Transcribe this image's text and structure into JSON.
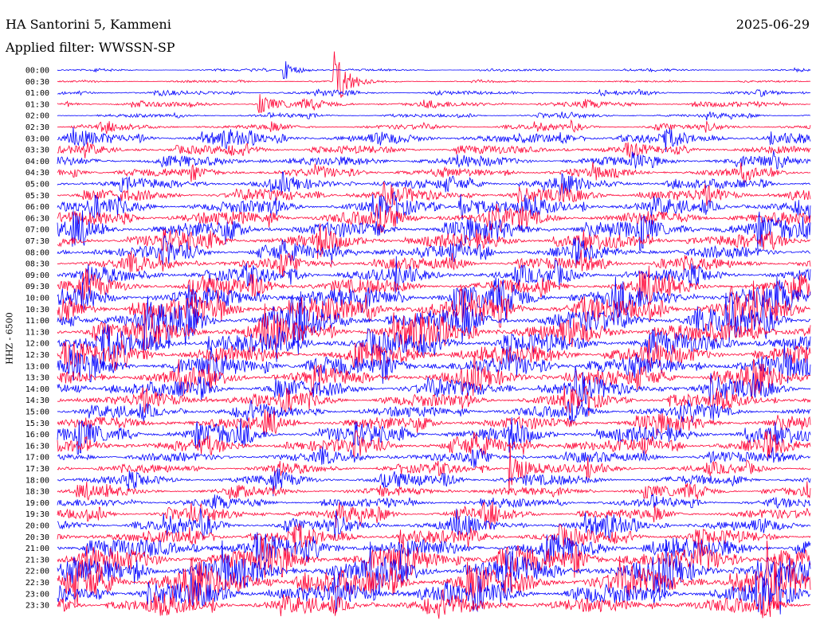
{
  "header": {
    "station": "HA Santorini 5, Kammeni",
    "date": "2025-06-29",
    "filter": "Applied filter: WWSSN-SP"
  },
  "chart_data": {
    "type": "line",
    "title": "HA Santorini 5, Kammeni",
    "ylabel": "HHZ - 6500",
    "rows": [
      "00:00",
      "00:30",
      "01:00",
      "01:30",
      "02:00",
      "02:30",
      "03:00",
      "03:30",
      "04:00",
      "04:30",
      "05:00",
      "05:30",
      "06:00",
      "06:30",
      "07:00",
      "07:30",
      "08:00",
      "08:30",
      "09:00",
      "09:30",
      "10:00",
      "10:30",
      "11:00",
      "11:30",
      "12:00",
      "12:30",
      "13:00",
      "13:30",
      "14:00",
      "14:30",
      "15:00",
      "15:30",
      "16:00",
      "16:30",
      "17:00",
      "17:30",
      "18:00",
      "18:30",
      "19:00",
      "19:30",
      "20:00",
      "20:30",
      "21:00",
      "21:30",
      "22:00",
      "22:30",
      "23:00",
      "23:30"
    ],
    "colors": [
      "#0000ff",
      "#ff0033"
    ],
    "noise_level": [
      1,
      1,
      2,
      3,
      2,
      3,
      6,
      5,
      6,
      5,
      6,
      7,
      8,
      9,
      10,
      9,
      8,
      7,
      8,
      9,
      12,
      14,
      14,
      13,
      12,
      12,
      11,
      10,
      10,
      8,
      7,
      8,
      9,
      8,
      6,
      5,
      6,
      5,
      5,
      6,
      7,
      8,
      12,
      14,
      15,
      16,
      12,
      9
    ],
    "events": [
      {
        "row": "00:00",
        "minute": 9,
        "amplitude": 14
      },
      {
        "row": "00:30",
        "minute": 11,
        "amplitude": 48
      },
      {
        "row": "01:30",
        "minute": 8,
        "amplitude": 14
      },
      {
        "row": "06:00",
        "minute": 16,
        "amplitude": 22
      },
      {
        "row": "17:30",
        "minute": 18,
        "amplitude": 40
      }
    ]
  }
}
